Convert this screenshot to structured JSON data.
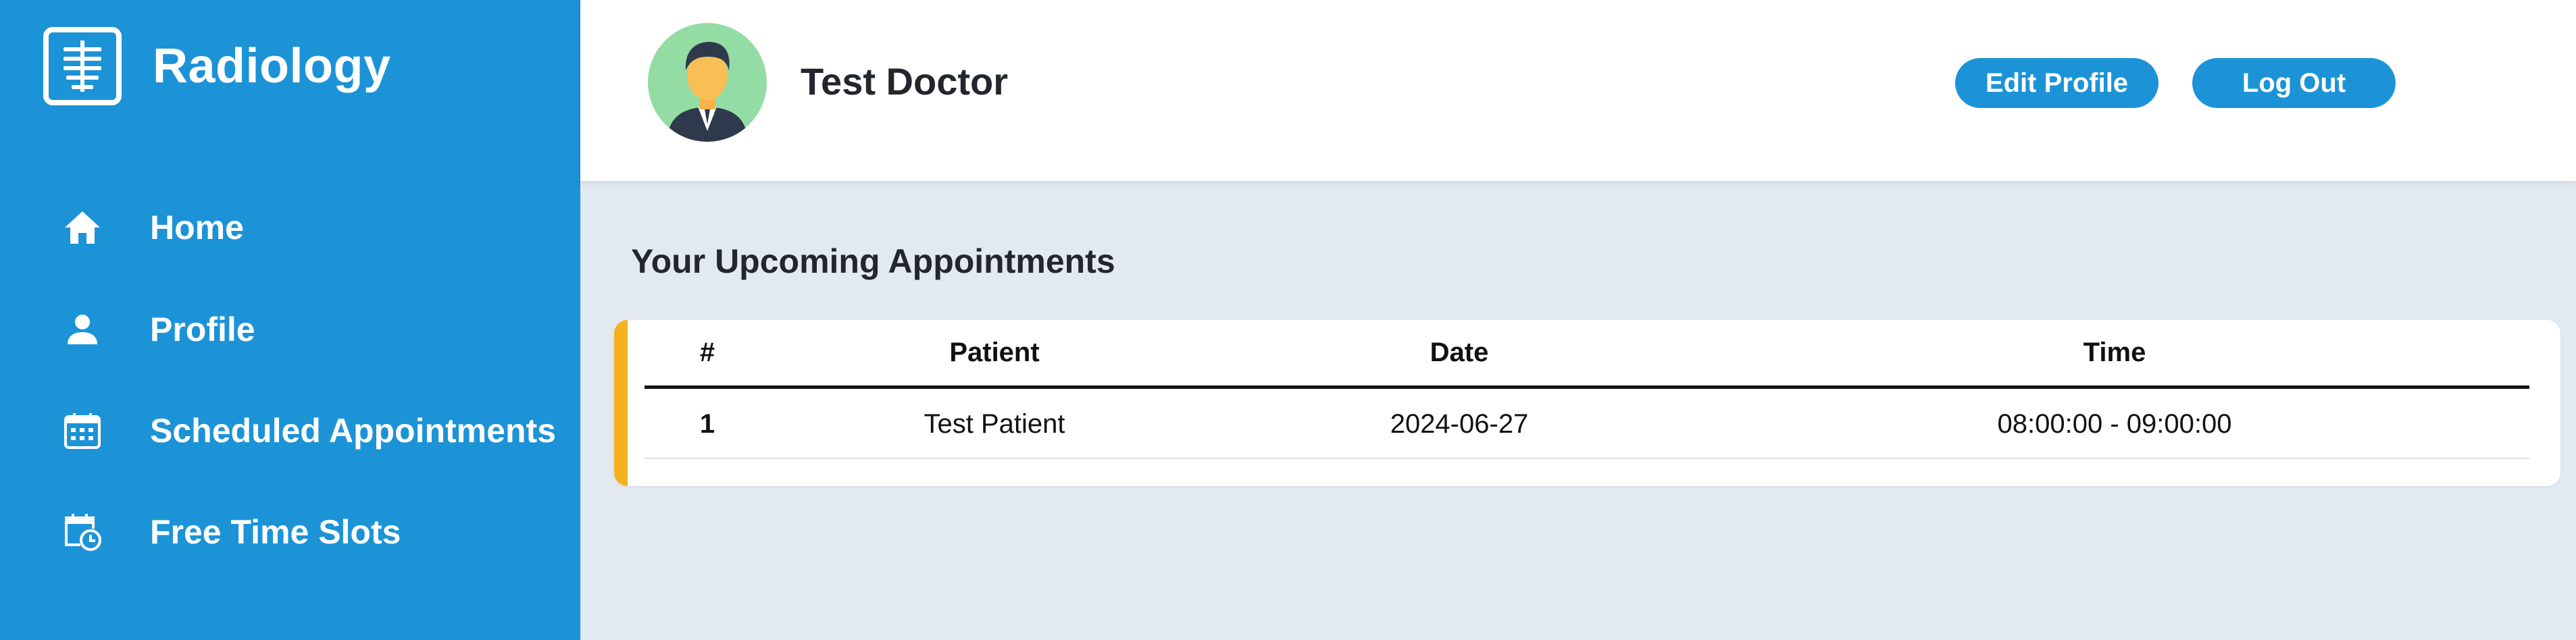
{
  "app": {
    "title": "Radiology"
  },
  "sidebar": {
    "items": [
      {
        "label": "Home",
        "icon": "home-icon"
      },
      {
        "label": "Profile",
        "icon": "user-icon"
      },
      {
        "label": "Scheduled Appointments",
        "icon": "calendar-icon"
      },
      {
        "label": "Free Time Slots",
        "icon": "calendar-clock-icon"
      }
    ]
  },
  "header": {
    "doctor_name": "Test Doctor",
    "edit_profile_label": "Edit Profile",
    "logout_label": "Log Out"
  },
  "main": {
    "section_title": "Your Upcoming Appointments",
    "table": {
      "columns": [
        "#",
        "Patient",
        "Date",
        "Time"
      ],
      "rows": [
        {
          "index": "1",
          "patient": "Test Patient",
          "date": "2024-06-27",
          "time": "08:00:00 - 09:00:00"
        }
      ]
    }
  },
  "colors": {
    "primary": "#1c93d7",
    "accent": "#f4b21c",
    "background": "#e3e9f1",
    "avatar_bg": "#93dda5"
  }
}
